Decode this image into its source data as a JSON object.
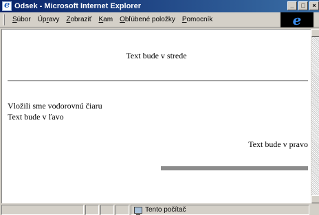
{
  "window": {
    "title": "Odsek - Microsoft Internet Explorer",
    "app_icon": "ie-icon",
    "controls": {
      "minimize": "_",
      "maximize": "□",
      "close": "×"
    }
  },
  "menu": {
    "items": [
      {
        "label": "Súbor",
        "underline": "S",
        "rest": "úbor"
      },
      {
        "label": "Úpravy",
        "pre": "Úp",
        "underline": "r",
        "rest": "avy"
      },
      {
        "label": "Zobraziť",
        "underline": "Z",
        "rest": "obraziť"
      },
      {
        "label": "Kam",
        "underline": "K",
        "rest": "am"
      },
      {
        "label": "Obľúbené položky",
        "underline": "O",
        "rest": "bľúbené položky"
      },
      {
        "label": "Pomocník",
        "underline": "P",
        "rest": "omocník"
      }
    ],
    "throbber_glyph": "e"
  },
  "content": {
    "center_text": "Text bude v strede",
    "left_line1": "Vložili sme vodorovnú čiaru",
    "left_line2": "Text bude v ľavo",
    "right_text": "Text bude v pravo"
  },
  "status": {
    "zone_text": "Tento počítač",
    "zone_icon": "computer-icon"
  }
}
